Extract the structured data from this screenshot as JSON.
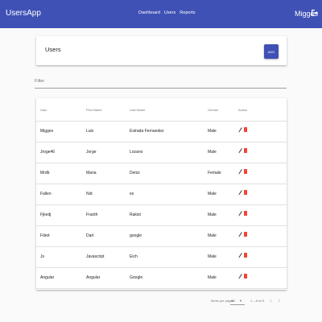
{
  "app": {
    "title": "UsersApp",
    "user": "Migges"
  },
  "nav": {
    "items": [
      "Dashboard",
      "Users",
      "Reports"
    ]
  },
  "users_card": {
    "title": "Users",
    "add_label": "ADD"
  },
  "filter": {
    "label": "Filter"
  },
  "table": {
    "columns": [
      "User",
      "First Name",
      "Last Name",
      "Gender",
      "Action"
    ],
    "rows": [
      [
        "Migges",
        "Luis",
        "Estrada Fernandez",
        "Male"
      ],
      [
        "Jroge46",
        "Jorge",
        "Lozano",
        "Male"
      ],
      [
        "Mrdb",
        "Maria",
        "Deniz",
        "Female"
      ],
      [
        "Fallen",
        "Nid",
        "es",
        "Male"
      ],
      [
        "Fjkedj",
        "Franth",
        "Rakist",
        "Male"
      ],
      [
        "Fdert",
        "Dart",
        "google",
        "Male"
      ],
      [
        "Js",
        "Javascript",
        "Eich",
        "Male"
      ],
      [
        "Angular",
        "Angular",
        "Google",
        "Male"
      ]
    ]
  },
  "paginator": {
    "items_per_page_label": "Items per page:",
    "items_per_page": "10",
    "range": "1 – 8 of 8"
  },
  "colors": {
    "primary": "#3f51b5",
    "delete": "#f44336"
  },
  "icons": {
    "logout": "logout-icon",
    "edit": "pencil-icon",
    "delete": "trash-icon",
    "prev": "chevron-left-icon",
    "next": "chevron-right-icon"
  }
}
